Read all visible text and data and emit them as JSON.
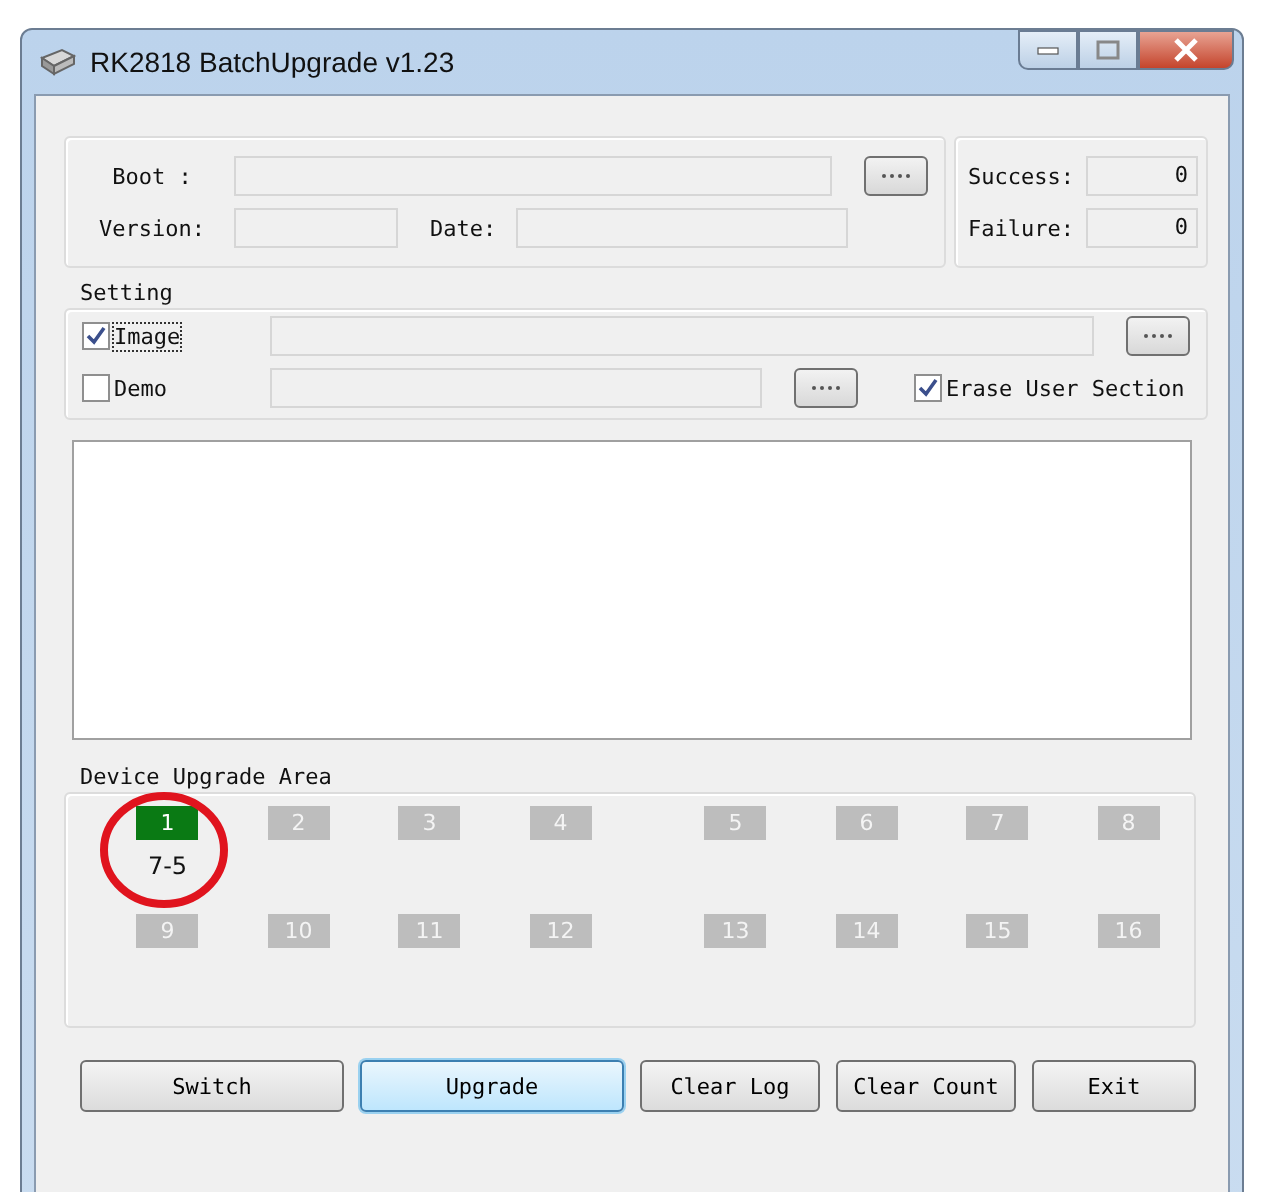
{
  "window": {
    "title": "RK2818 BatchUpgrade v1.23"
  },
  "boot": {
    "label": "Boot :"
  },
  "version": {
    "label": "Version:"
  },
  "date": {
    "label": "Date:"
  },
  "counters": [
    {
      "label": "Success:",
      "value": "0"
    },
    {
      "label": "Failure:",
      "value": "0"
    }
  ],
  "setting": {
    "title": "Setting",
    "image": {
      "label": "Image",
      "checked": true
    },
    "demo": {
      "label": "Demo",
      "checked": false
    },
    "erase": {
      "label": "Erase User Section",
      "checked": true
    }
  },
  "device_area": {
    "title": "Device Upgrade Area",
    "devices": [
      {
        "label": "1",
        "active": true,
        "status": "7-5",
        "circled": true
      },
      {
        "label": "2",
        "active": false,
        "circled": false
      },
      {
        "label": "3",
        "active": false,
        "circled": false
      },
      {
        "label": "4",
        "active": false,
        "circled": false
      },
      {
        "label": "5",
        "active": false,
        "circled": false
      },
      {
        "label": "6",
        "active": false,
        "circled": false
      },
      {
        "label": "7",
        "active": false,
        "circled": false
      },
      {
        "label": "8",
        "active": false,
        "circled": false
      },
      {
        "label": "9",
        "active": false,
        "circled": false
      },
      {
        "label": "10",
        "active": false,
        "circled": false
      },
      {
        "label": "11",
        "active": false,
        "circled": false
      },
      {
        "label": "12",
        "active": false,
        "circled": false
      },
      {
        "label": "13",
        "active": false,
        "circled": false
      },
      {
        "label": "14",
        "active": false,
        "circled": false
      },
      {
        "label": "15",
        "active": false,
        "circled": false
      },
      {
        "label": "16",
        "active": false,
        "circled": false
      }
    ]
  },
  "buttons": [
    {
      "label": "Switch",
      "selected": false
    },
    {
      "label": "Upgrade",
      "selected": true
    },
    {
      "label": "Clear Log",
      "selected": false
    },
    {
      "label": "Clear Count",
      "selected": false
    },
    {
      "label": "Exit",
      "selected": false
    }
  ]
}
